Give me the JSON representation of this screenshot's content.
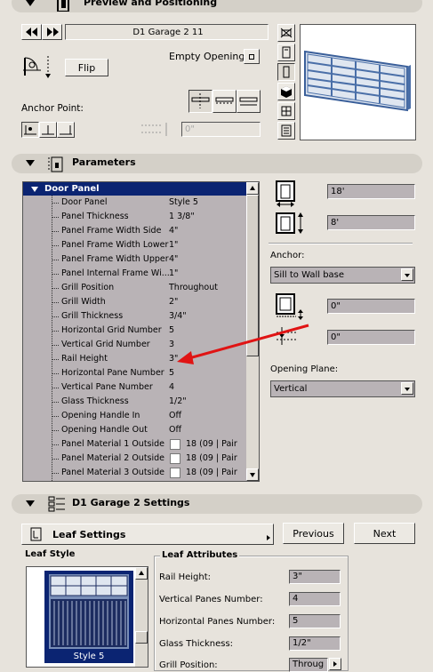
{
  "preview_section": {
    "title": "Preview and Positioning",
    "object_name": "D1 Garage 2 11",
    "flip_label": "Flip",
    "empty_opening_label": "Empty Opening",
    "anchor_point_label": "Anchor Point:",
    "offset_value": "0\""
  },
  "parameters_section": {
    "title": "Parameters",
    "width_value": "18'",
    "height_value": "8'",
    "anchor_label": "Anchor:",
    "anchor_value": "Sill to Wall base",
    "sill_value": "0\"",
    "offset_value": "0\"",
    "opening_plane_label": "Opening Plane:",
    "opening_plane_value": "Vertical",
    "tree": {
      "group": "Door Panel",
      "rows": [
        {
          "name": "Door Panel",
          "value": "Style 5"
        },
        {
          "name": "Panel Thickness",
          "value": "1 3/8\""
        },
        {
          "name": "Panel Frame Width Side",
          "value": "4\""
        },
        {
          "name": "Panel Frame Width Lower",
          "value": "1\""
        },
        {
          "name": "Panel Frame Width Upper",
          "value": "4\""
        },
        {
          "name": "Panel Internal Frame Wi...",
          "value": "1\""
        },
        {
          "name": "Grill Position",
          "value": "Throughout"
        },
        {
          "name": "Grill Width",
          "value": "2\""
        },
        {
          "name": "Grill Thickness",
          "value": "3/4\""
        },
        {
          "name": "Horizontal Grid Number",
          "value": "5"
        },
        {
          "name": "Vertical Grid Number",
          "value": "3"
        },
        {
          "name": "Rail Height",
          "value": "3\""
        },
        {
          "name": "Horizontal Pane Number",
          "value": "5"
        },
        {
          "name": "Vertical Pane Number",
          "value": "4"
        },
        {
          "name": "Glass Thickness",
          "value": "1/2\""
        },
        {
          "name": "Opening Handle In",
          "value": "Off"
        },
        {
          "name": "Opening Handle Out",
          "value": "Off"
        },
        {
          "name": "Panel Material 1 Outside",
          "value": "18 (09 | Pair"
        },
        {
          "name": "Panel Material 2 Outside",
          "value": "18 (09 | Pair"
        },
        {
          "name": "Panel Material 3 Outside",
          "value": "18 (09 | Pair"
        }
      ]
    }
  },
  "settings_section": {
    "title": "D1 Garage 2 Settings",
    "page_label": "Leaf Settings",
    "previous_label": "Previous",
    "next_label": "Next",
    "leaf_style_label": "Leaf Style",
    "style_caption": "Style 5",
    "leaf_attributes_label": "Leaf Attributes",
    "rail_height_label": "Rail Height:",
    "rail_height_value": "3\"",
    "vertical_panes_label": "Vertical Panes Number:",
    "vertical_panes_value": "4",
    "horizontal_panes_label": "Horizontal Panes Number:",
    "horizontal_panes_value": "5",
    "glass_thickness_label": "Glass Thickness:",
    "glass_thickness_value": "1/2\"",
    "grill_position_label": "Grill Position:",
    "grill_position_value": "Throug"
  },
  "colors": {
    "panel_bg": "#e7e3dc",
    "field_bg": "#b9b3b6",
    "tree_header": "#0b2472",
    "arrow": "#e01414",
    "preview_blue": "#4a6fa8"
  }
}
